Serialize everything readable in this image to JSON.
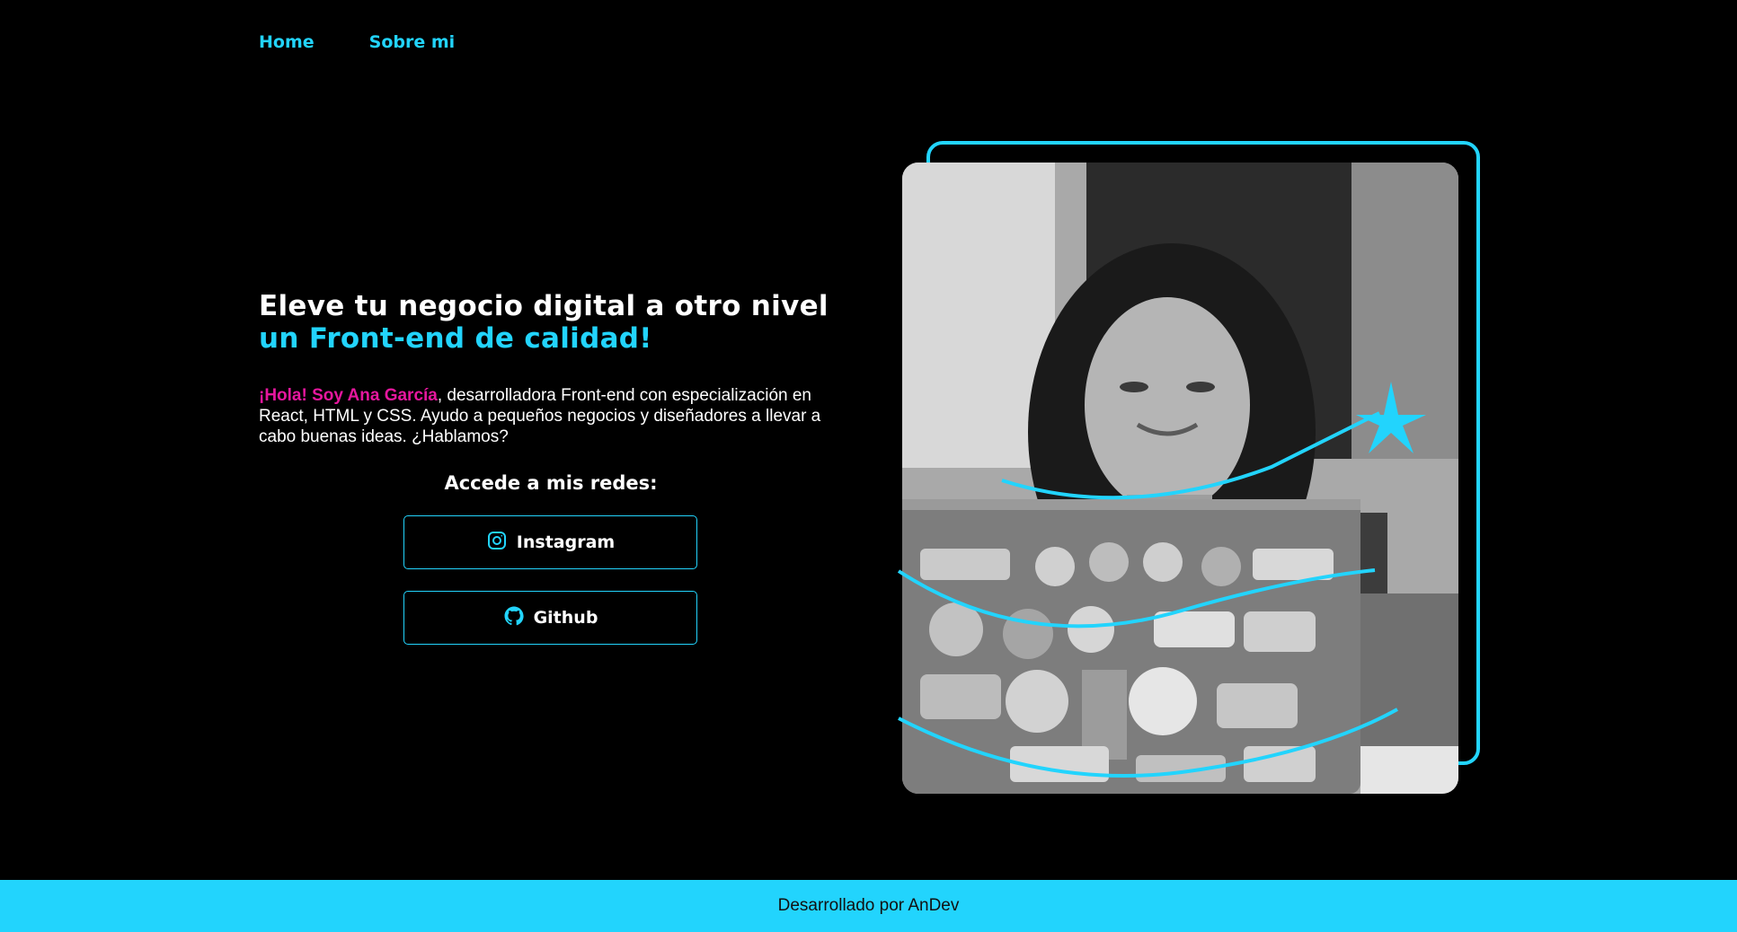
{
  "nav": {
    "items": [
      "Home",
      "Sobre mi"
    ]
  },
  "hero": {
    "headline_line1": "Eleve tu negocio digital a otro nivel",
    "headline_line2": "un Front-end de calidad!",
    "intro_highlight": "¡Hola! Soy Ana García",
    "intro_rest": ", desarrolladora Front-end con especialización en React, HTML y CSS. Ayudo a pequeños negocios y diseñadores a llevar a cabo buenas ideas. ¿Hablamos?",
    "redes_title": "Accede a mis redes:",
    "buttons": [
      {
        "label": "Instagram",
        "icon": "instagram-icon"
      },
      {
        "label": "Github",
        "icon": "github-icon"
      }
    ]
  },
  "photo": {
    "alt": ""
  },
  "footer": {
    "text": "Desarrollado por AnDev"
  },
  "colors": {
    "accent": "#22d4fd",
    "highlight": "#e6179e",
    "background": "#000000"
  }
}
